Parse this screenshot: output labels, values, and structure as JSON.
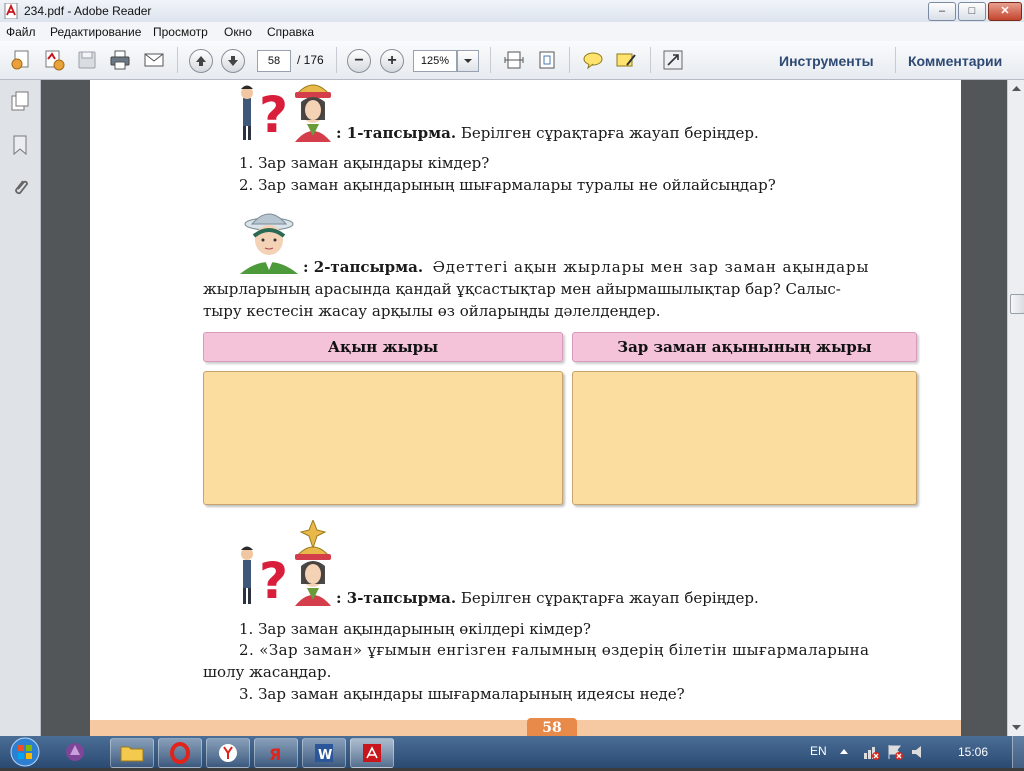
{
  "window": {
    "title": "234.pdf - Adobe Reader",
    "minimize": "–",
    "maximize": "□",
    "close": "✕"
  },
  "menu": [
    "Файл",
    "Редактирование",
    "Просмотр",
    "Окно",
    "Справка"
  ],
  "toolbar": {
    "page_number": "58",
    "page_total": "/ 176",
    "zoom": "125%",
    "tools_label": "Инструменты",
    "comments_label": "Комментарии"
  },
  "document": {
    "task1": {
      "title": "1-тапсырма.",
      "prefix": ": ",
      "text": "Берілген сұрақтарға жауап беріңдер.",
      "questions": [
        "1. Зар заман ақындары кімдер?",
        "2. Зар заман ақындарының шығармалары туралы не ойлайсыңдар?"
      ]
    },
    "task2": {
      "prefix": ": ",
      "title": "2-тапсырма.",
      "lines": [
        "Әдеттегі ақын жырлары мен зар заман ақындары",
        "жырларының арасында қандай ұқсастықтар мен айырмашылықтар бар? Салыс-",
        "тыру кестесін жасау арқылы өз ойларыңды дәлелдеңдер."
      ],
      "table_headers": [
        "Ақын жыры",
        "Зар заман ақынының жыры"
      ]
    },
    "task3": {
      "prefix": ": ",
      "title": "3-тапсырма.",
      "text": "Берілген сұрақтарға жауап беріңдер.",
      "lines": [
        "1. Зар заман ақындарының өкілдері кімдер?",
        "2. «Зар заман» ұғымын енгізген ғалымның өздерің білетін шығармаларына",
        "шолу жасаңдар.",
        "3.  Зар заман ақындары шығармаларының идеясы неде?"
      ]
    },
    "page_footer_number": "58"
  },
  "taskbar": {
    "language": "EN",
    "clock": "15:06"
  },
  "colors": {
    "pink_header": "#f4c3da",
    "table_body": "#fbdd9f",
    "footer_band": "#f6c9a3",
    "page_badge": "#e88a4a",
    "toolbar_link": "#2e4a74"
  }
}
